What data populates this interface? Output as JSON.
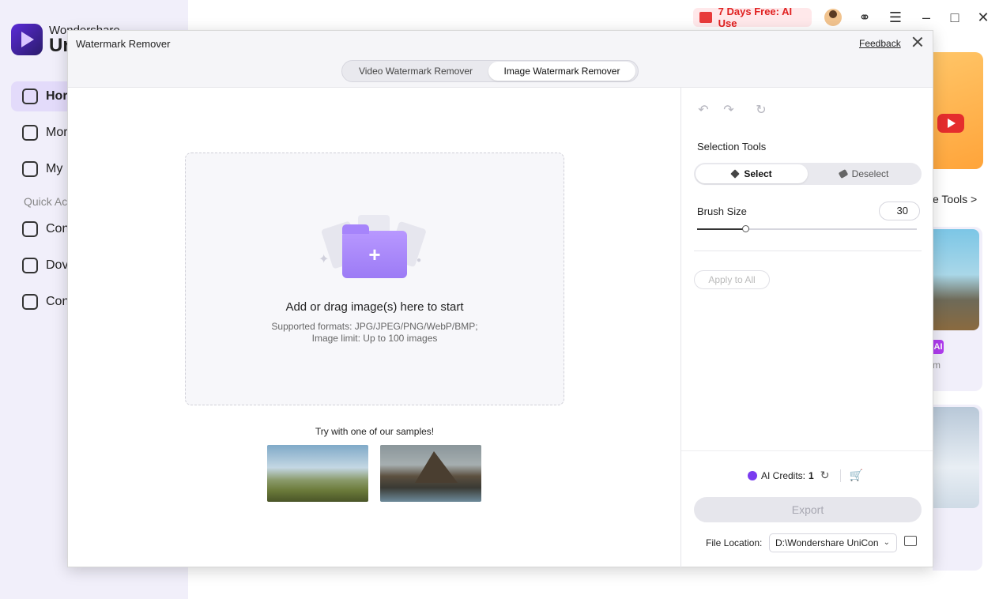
{
  "background_app": {
    "brand_line1": "Wondershare",
    "brand_line2": "Ur",
    "sidebar": [
      {
        "label": "Hor",
        "active": true
      },
      {
        "label": "Mor"
      },
      {
        "label": "My"
      },
      {
        "label": "Con"
      },
      {
        "label": "Dov"
      },
      {
        "label": "Con"
      }
    ],
    "quick_access": "Quick Ac",
    "promo": "7 Days Free: AI Use",
    "more_tools": "e Tools >",
    "card_badge": "AI",
    "card_text": "m"
  },
  "dialog": {
    "title": "Watermark Remover",
    "feedback": "Feedback",
    "tabs": [
      {
        "label": "Video Watermark Remover",
        "active": false
      },
      {
        "label": "Image Watermark Remover",
        "active": true
      }
    ],
    "drop": {
      "title": "Add or drag image(s) here to start",
      "formats": "Supported formats: JPG/JPEG/PNG/WebP/BMP;",
      "limit": "Image limit: Up to 100 images"
    },
    "samples_label": "Try with one of our samples!",
    "panel": {
      "selection_tools": "Selection Tools",
      "select": "Select",
      "deselect": "Deselect",
      "brush_size_label": "Brush Size",
      "brush_size": "30",
      "brush_fraction": 0.22,
      "apply_all": "Apply to All",
      "credits_label": "AI Credits:",
      "credits_value": "1",
      "export": "Export",
      "file_location_label": "File Location:",
      "file_location": "D:\\Wondershare UniCon"
    }
  },
  "colors": {
    "accent": "#7a3cf0",
    "promo_red": "#e02020"
  }
}
